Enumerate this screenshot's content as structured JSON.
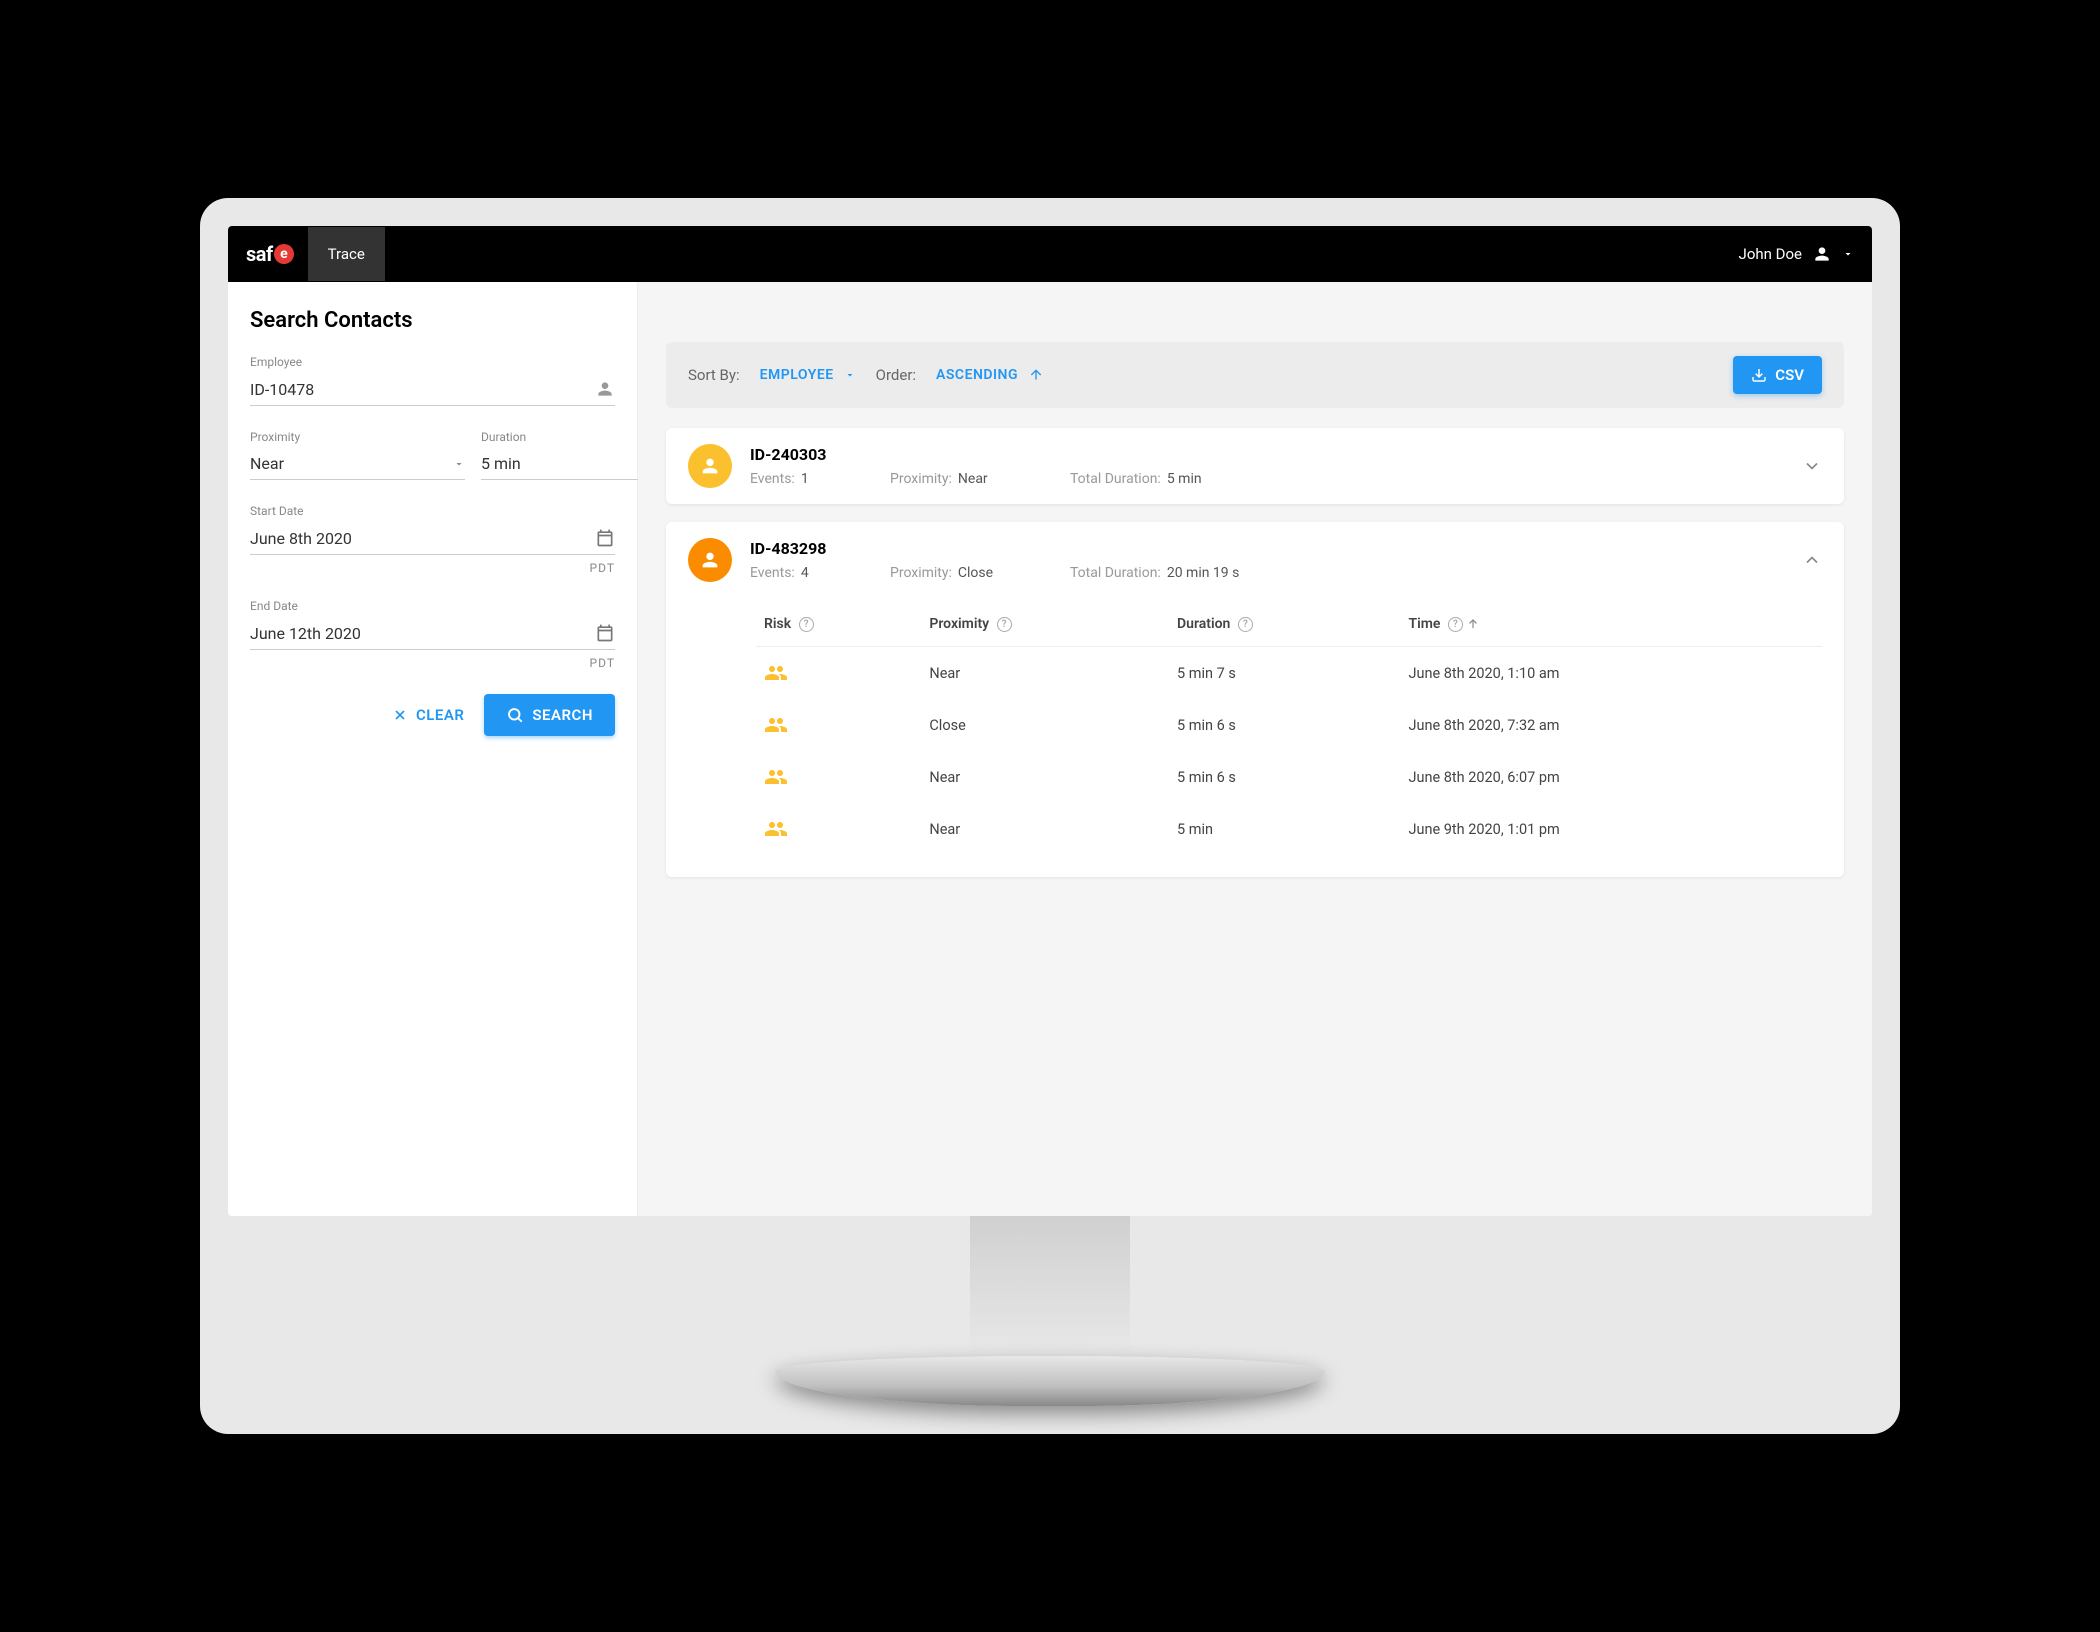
{
  "topbar": {
    "logo_prefix": "saf",
    "logo_suffix": "e",
    "nav_trace": "Trace",
    "user_name": "John Doe"
  },
  "sidebar": {
    "title": "Search Contacts",
    "employee_label": "Employee",
    "employee_value": "ID-10478",
    "proximity_label": "Proximity",
    "proximity_value": "Near",
    "duration_label": "Duration",
    "duration_value": "5 min",
    "start_date_label": "Start Date",
    "start_date_value": "June 8th 2020",
    "end_date_label": "End Date",
    "end_date_value": "June 12th 2020",
    "tz": "PDT",
    "clear_label": "CLEAR",
    "search_label": "SEARCH"
  },
  "sortbar": {
    "sort_by_label": "Sort By:",
    "sort_by_value": "EMPLOYEE",
    "order_label": "Order:",
    "order_value": "ASCENDING",
    "csv_label": "CSV"
  },
  "labels": {
    "events": "Events:",
    "proximity": "Proximity:",
    "total_duration": "Total Duration:",
    "col_risk": "Risk",
    "col_proximity": "Proximity",
    "col_duration": "Duration",
    "col_time": "Time"
  },
  "results": [
    {
      "id": "ID-240303",
      "avatar_color": "yellow",
      "expanded": false,
      "events_count": "1",
      "proximity": "Near",
      "total_duration": "5 min"
    },
    {
      "id": "ID-483298",
      "avatar_color": "orange",
      "expanded": true,
      "events_count": "4",
      "proximity": "Close",
      "total_duration": "20 min 19 s",
      "events": [
        {
          "proximity": "Near",
          "duration": "5 min 7 s",
          "time": "June 8th 2020, 1:10 am"
        },
        {
          "proximity": "Close",
          "duration": "5 min 6 s",
          "time": "June 8th 2020, 7:32 am"
        },
        {
          "proximity": "Near",
          "duration": "5 min 6 s",
          "time": "June 8th 2020, 6:07 pm"
        },
        {
          "proximity": "Near",
          "duration": "5 min",
          "time": "June 9th 2020, 1:01 pm"
        }
      ]
    }
  ]
}
